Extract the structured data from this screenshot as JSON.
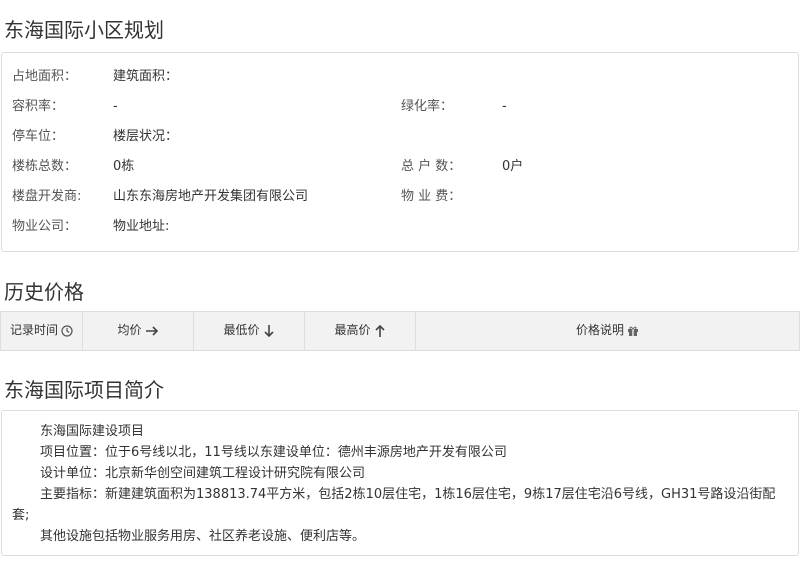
{
  "sections": {
    "plan_title": "东海国际小区规划",
    "history_title": "历史价格",
    "intro_title": "东海国际项目简介"
  },
  "plan": {
    "land_area_label": "占地面积：",
    "land_area_value": "",
    "build_area_label": "建筑面积：",
    "build_area_value": "",
    "plot_ratio_label": "容积率：",
    "plot_ratio_value": "-",
    "green_ratio_label": "绿化率：",
    "green_ratio_value": "-",
    "parking_label": "停车位：",
    "parking_value": "",
    "floor_status_label": "楼层状况：",
    "floor_status_value": "",
    "buildings_label": "楼栋总数：",
    "buildings_value": "0栋",
    "households_label": "总 户 数：",
    "households_value": "0户",
    "developer_label": "楼盘开发商:",
    "developer_value": "山东东海房地产开发集团有限公司",
    "property_fee_label": "物 业 费：",
    "property_fee_value": "",
    "property_company_label": "物业公司：",
    "property_company_value": "",
    "property_address_label": "物业地址:",
    "property_address_value": ""
  },
  "history": {
    "columns": {
      "time": "记录时间",
      "avg": "均价",
      "min": "最低价",
      "max": "最高价",
      "note": "价格说明"
    },
    "icons": {
      "time": "clock-icon",
      "avg": "arrow-right-icon",
      "min": "arrow-down-icon",
      "max": "arrow-up-icon",
      "note": "gift-icon"
    }
  },
  "intro": {
    "lines": [
      "东海国际建设项目",
      "项目位置：位于6号线以北，11号线以东建设单位：德州丰源房地产开发有限公司",
      "设计单位：北京新华创空间建筑工程设计研究院有限公司",
      "主要指标：新建建筑面积为138813.74平方米，包括2栋10层住宅，1栋16层住宅，9栋17层住宅沿6号线，GH31号路设沿街配套;",
      "其他设施包括物业服务用房、社区养老设施、便利店等。"
    ]
  }
}
